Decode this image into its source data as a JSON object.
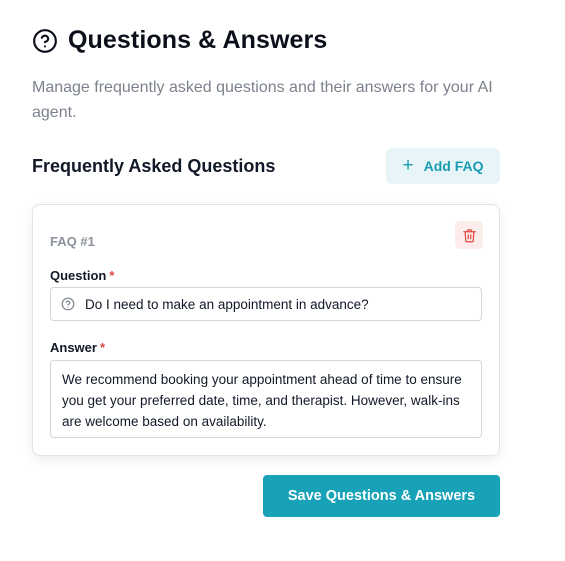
{
  "header": {
    "icon": "help-circle-icon",
    "title": "Questions & Answers",
    "description": "Manage frequently asked questions and their answers for your AI agent."
  },
  "faq_section": {
    "title": "Frequently Asked Questions",
    "add_button_label": "Add FAQ",
    "add_button_icon": "plus-icon",
    "items": [
      {
        "label": "FAQ #1",
        "question_label": "Question",
        "question_value": "Do I need to make an appointment in advance?",
        "answer_label": "Answer",
        "answer_value": "We recommend booking your appointment ahead of time to ensure you get your preferred date, time, and therapist. However, walk-ins are welcome based on availability.",
        "required_marker": "*",
        "delete_icon": "trash-icon"
      }
    ]
  },
  "footer": {
    "save_button_label": "Save Questions & Answers"
  },
  "colors": {
    "accent": "#17a2b8",
    "accent_light": "#e7f5f8",
    "danger": "#e0483e",
    "danger_light": "#fdecec",
    "muted_text": "#7b828c"
  }
}
